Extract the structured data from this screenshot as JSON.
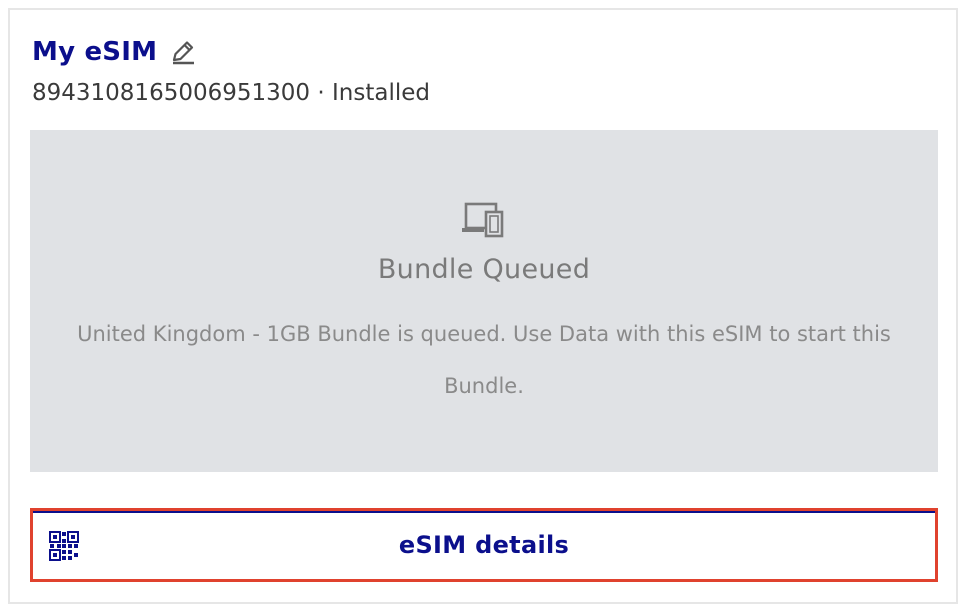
{
  "card": {
    "title": "My eSIM",
    "iccid": "8943108165006951300",
    "separator": " · ",
    "status": "Installed",
    "edit_icon": "pencil-edit-icon"
  },
  "panel": {
    "icon": "devices-icon",
    "heading": "Bundle Queued",
    "message": "United Kingdom - 1GB Bundle is queued. Use Data with this eSIM to start this Bundle."
  },
  "details_button": {
    "icon": "qr-code-icon",
    "label": "eSIM details"
  },
  "colors": {
    "brand_navy": "#0b0f8c",
    "highlight_red": "#e0422e",
    "panel_gray": "#e0e2e5",
    "muted_text": "#7a7a7a"
  }
}
